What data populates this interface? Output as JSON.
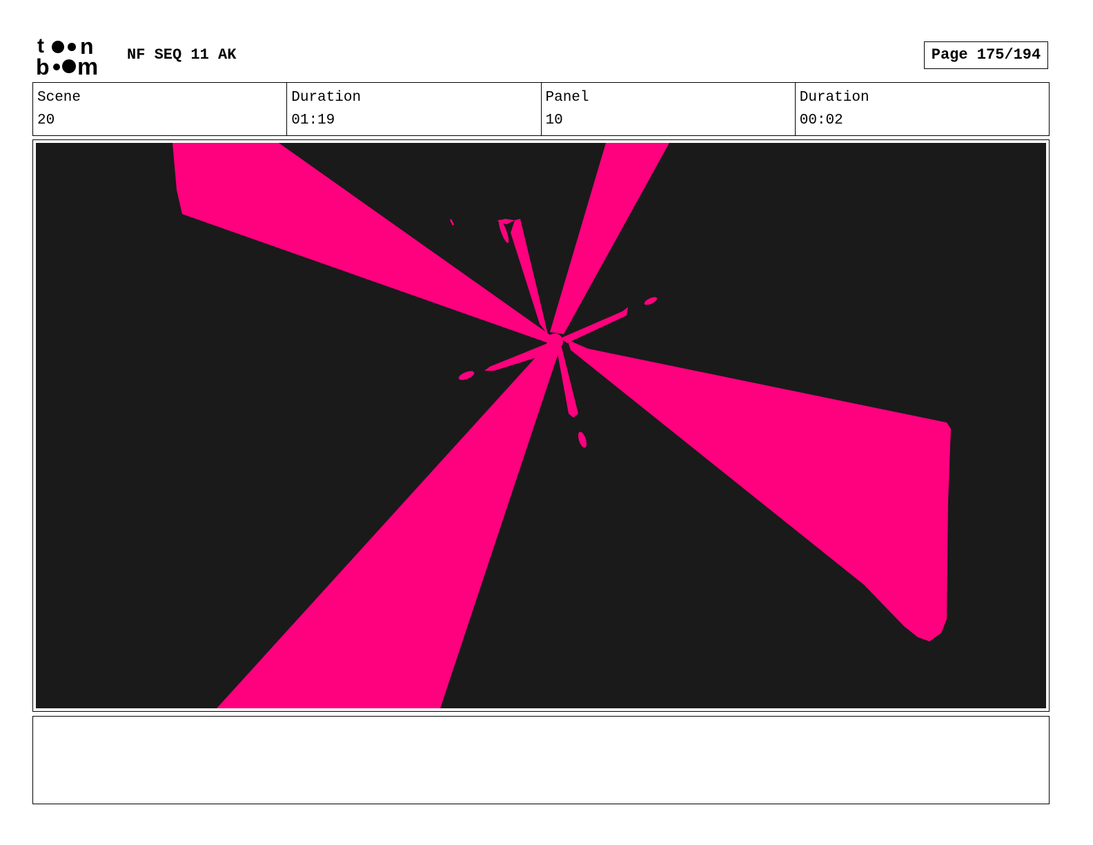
{
  "header": {
    "logo_text": "toon boom",
    "project_title": "NF SEQ 11 AK",
    "page_label": "Page 175/194"
  },
  "info": {
    "scene": {
      "label": "Scene",
      "value": "20"
    },
    "scene_duration": {
      "label": "Duration",
      "value": "01:19"
    },
    "panel": {
      "label": "Panel",
      "value": "10"
    },
    "panel_duration": {
      "label": "Duration",
      "value": "00:02"
    }
  },
  "panel_image": {
    "description_icon": "pink-light-burst-drawing",
    "background_color": "#1a1a1a",
    "ray_color": "#ff007f"
  },
  "notes": {
    "text": ""
  }
}
